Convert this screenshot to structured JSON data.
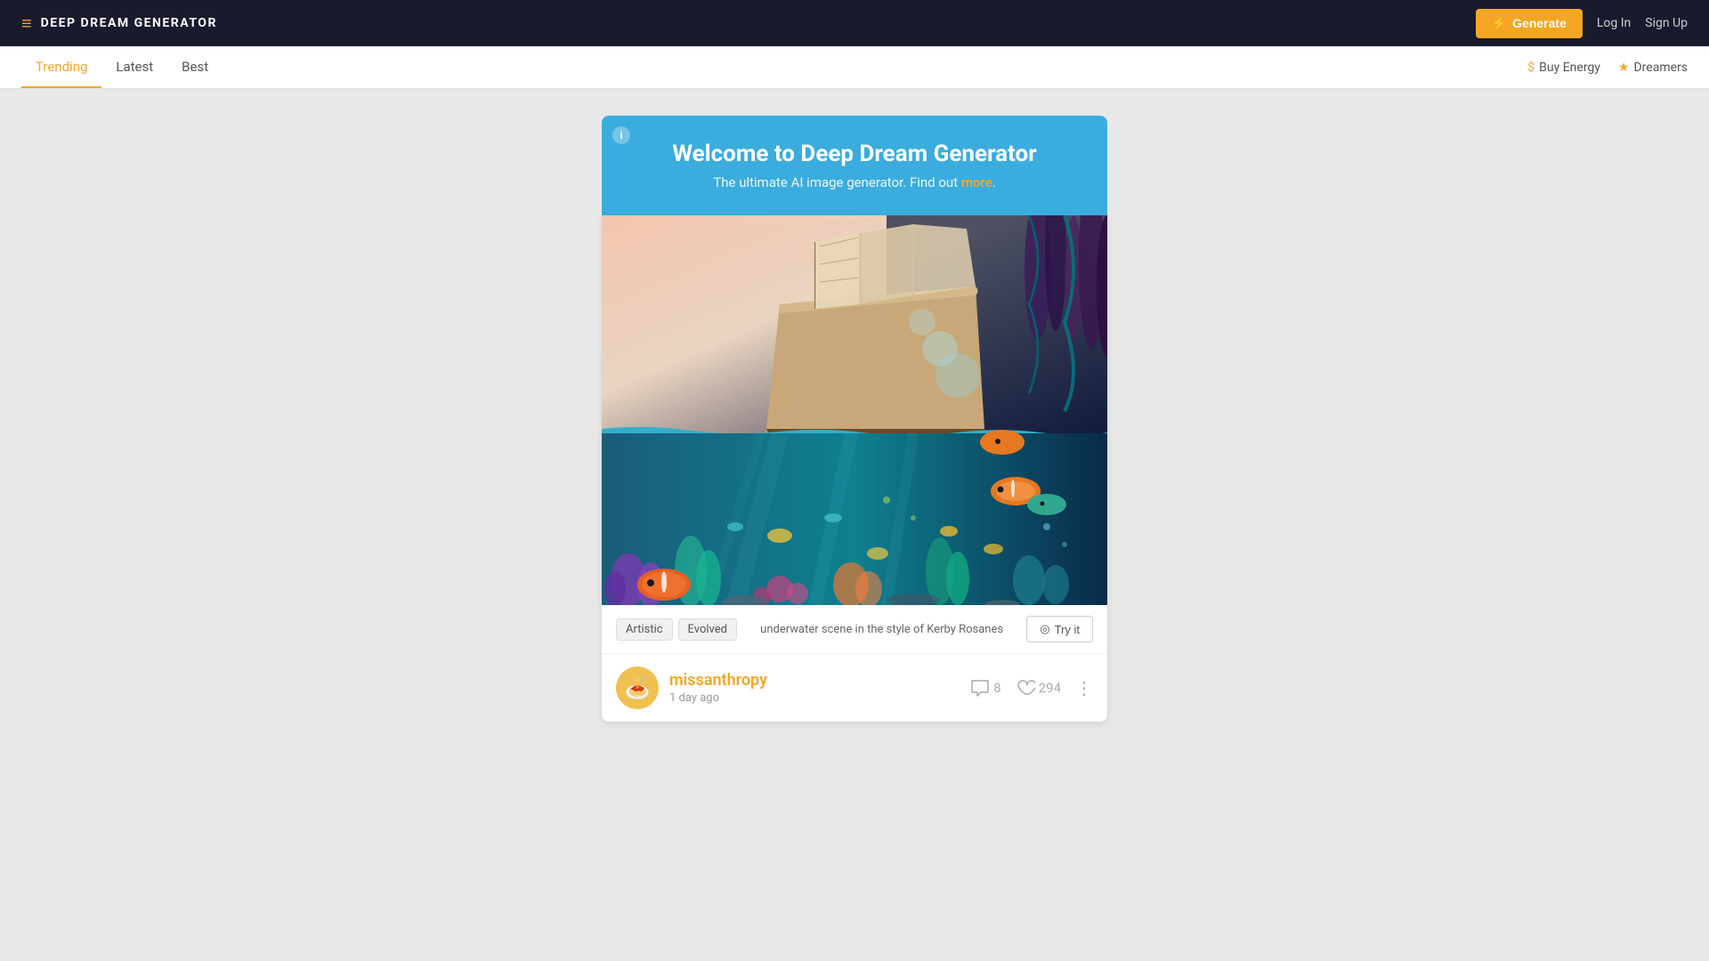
{
  "header": {
    "logo_icon": "≡",
    "app_title": "DEEP DREAM GENERATOR",
    "generate_label": "Generate",
    "login_label": "Log In",
    "signup_label": "Sign Up"
  },
  "nav": {
    "tabs": [
      {
        "label": "Trending",
        "active": true
      },
      {
        "label": "Latest",
        "active": false
      },
      {
        "label": "Best",
        "active": false
      }
    ],
    "right_items": [
      {
        "label": "Buy Energy",
        "icon": "$"
      },
      {
        "label": "Dreamers",
        "icon": "★"
      }
    ]
  },
  "welcome": {
    "title": "Welcome to Deep Dream Generator",
    "subtitle": "The ultimate AI image generator. Find out ",
    "link_text": "more",
    "subtitle_end": "."
  },
  "image_card": {
    "tags": [
      "Artistic",
      "Evolved"
    ],
    "description": "underwater scene in the style of Kerby Rosanes",
    "try_it_label": "Try it"
  },
  "user": {
    "username": "missanthropy",
    "timestamp": "1 day ago",
    "comment_count": "8",
    "like_count": "294"
  }
}
